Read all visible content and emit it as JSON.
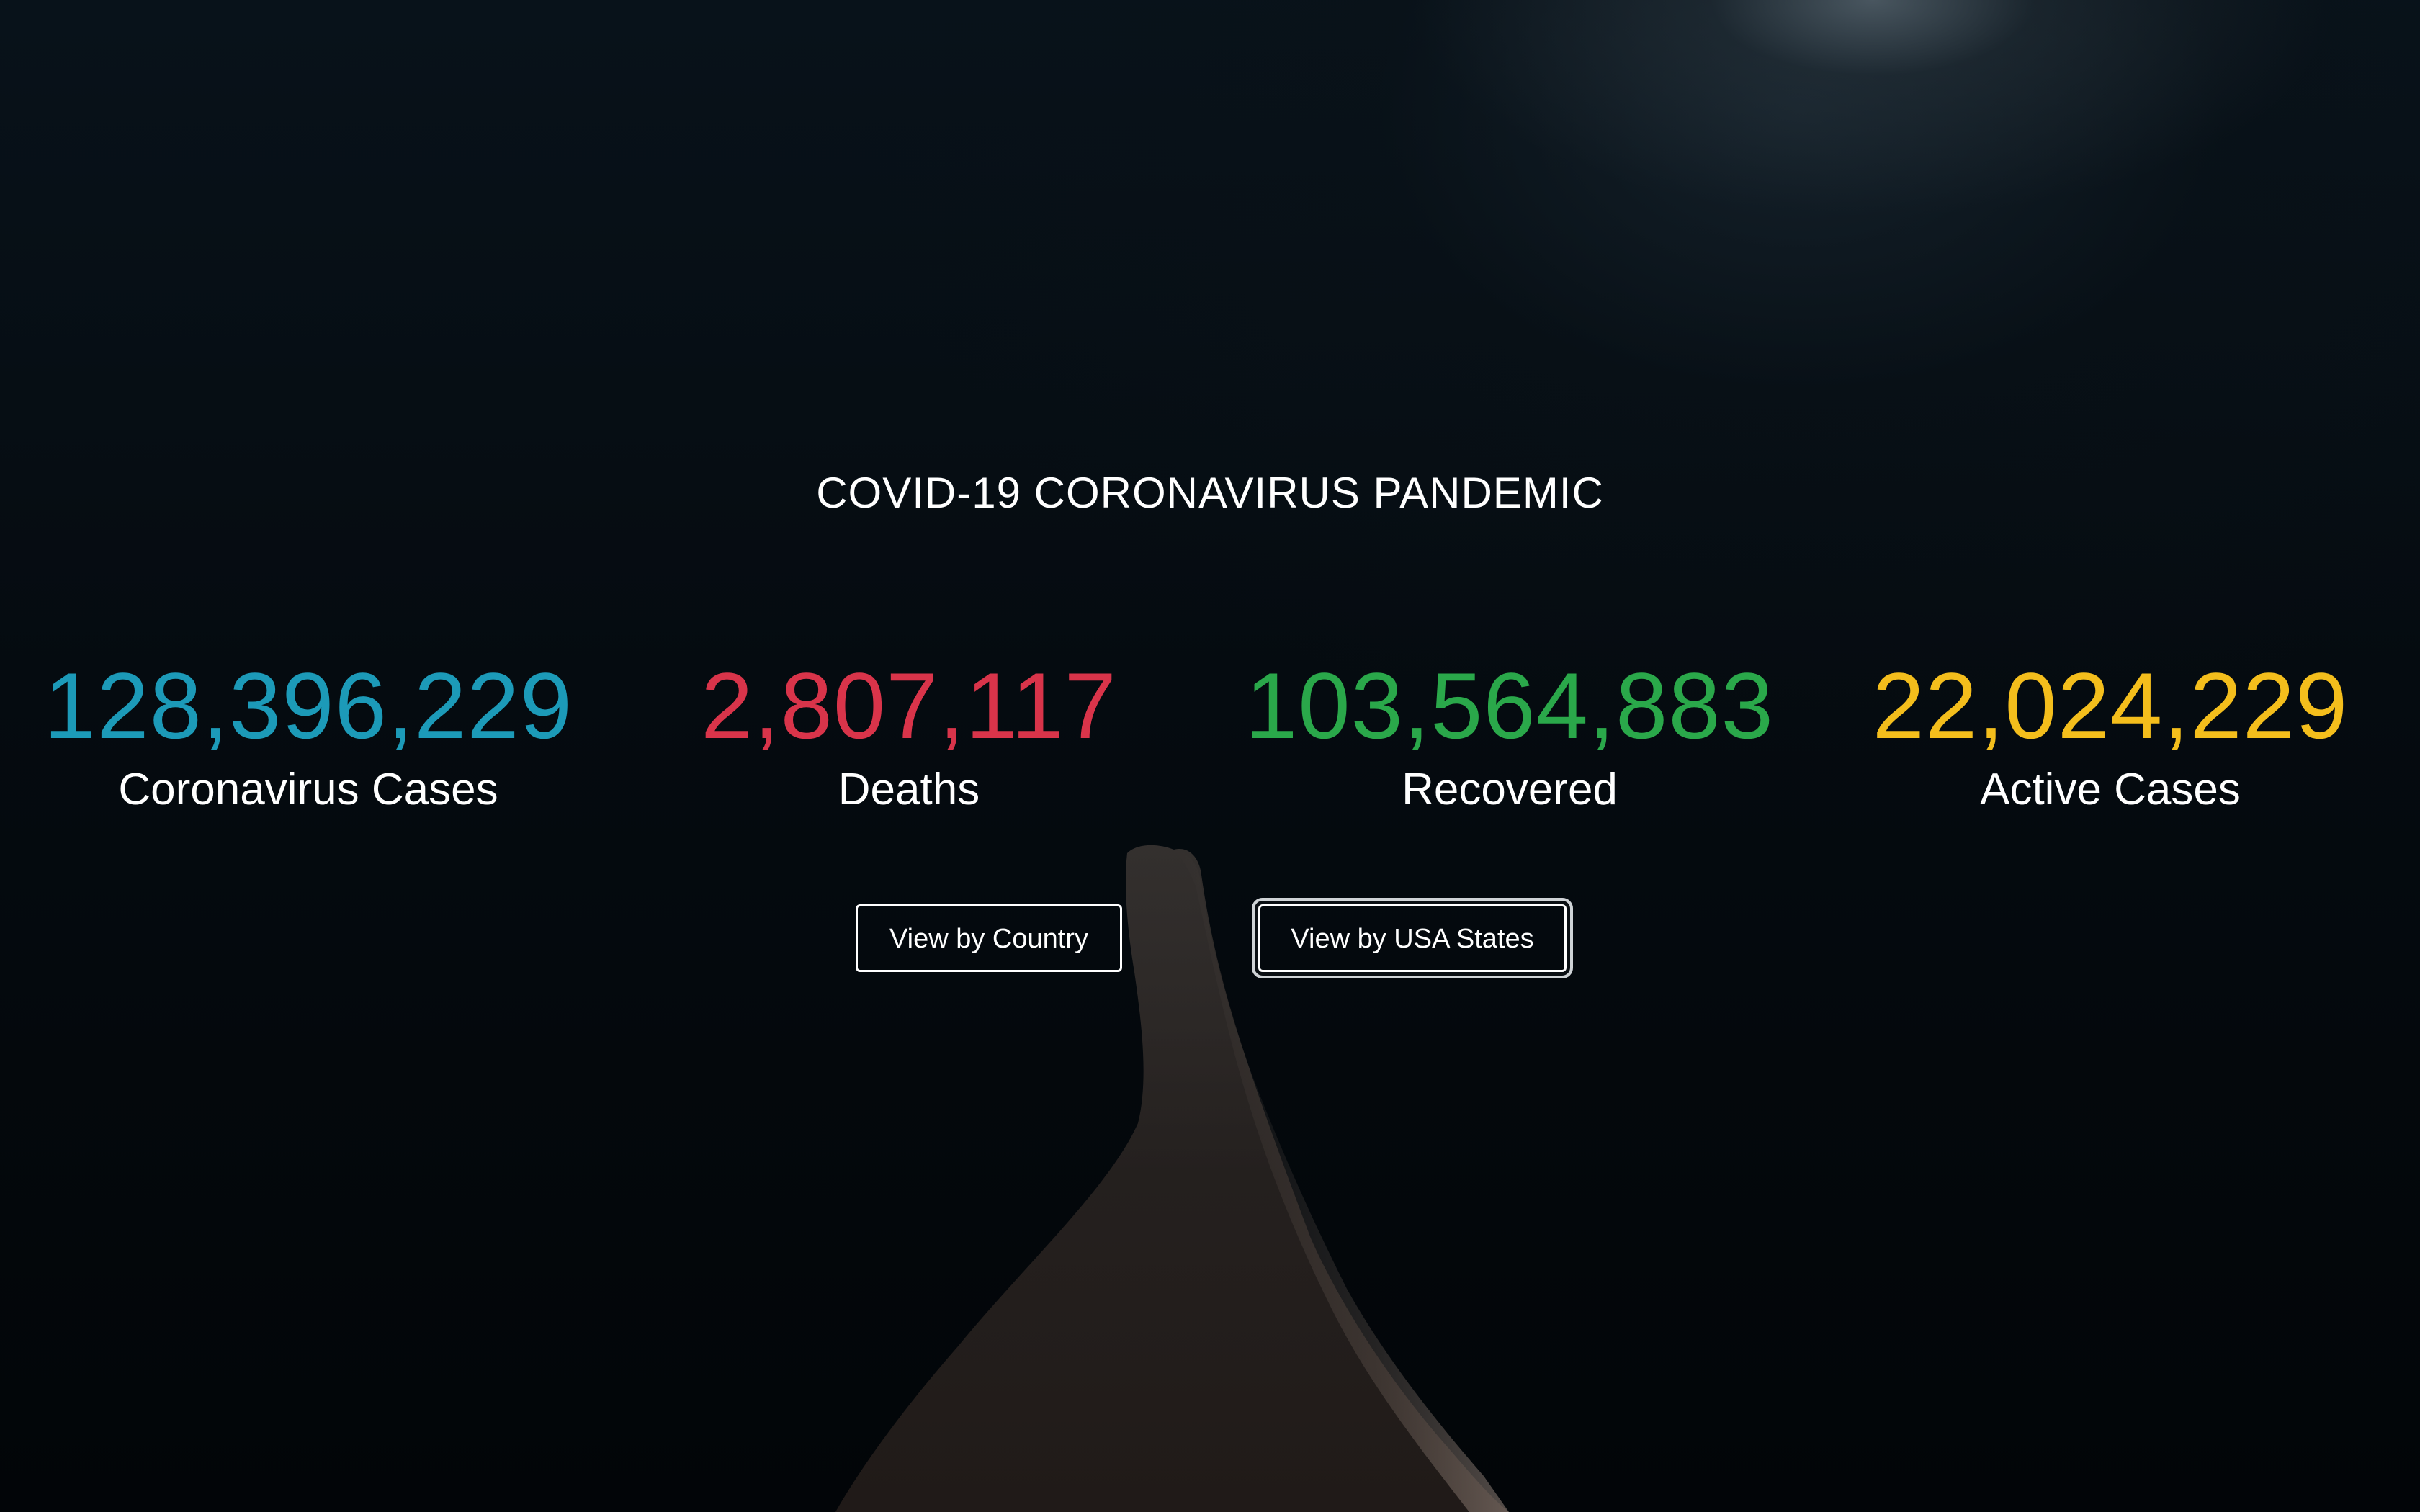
{
  "page": {
    "title": "COVID-19 CORONAVIRUS PANDEMIC"
  },
  "stats": [
    {
      "value": "128,396,229",
      "label": "Coronavirus Cases",
      "color": "#1c9ab8"
    },
    {
      "value": "2,807,117",
      "label": "Deaths",
      "color": "#d9344a"
    },
    {
      "value": "103,564,883",
      "label": "Recovered",
      "color": "#2aa84a"
    },
    {
      "value": "22,024,229",
      "label": "Active Cases",
      "color": "#f4be1c"
    }
  ],
  "buttons": {
    "country_label": "View by Country",
    "states_label": "View by USA States"
  },
  "background": {
    "image": "praying-hands"
  }
}
